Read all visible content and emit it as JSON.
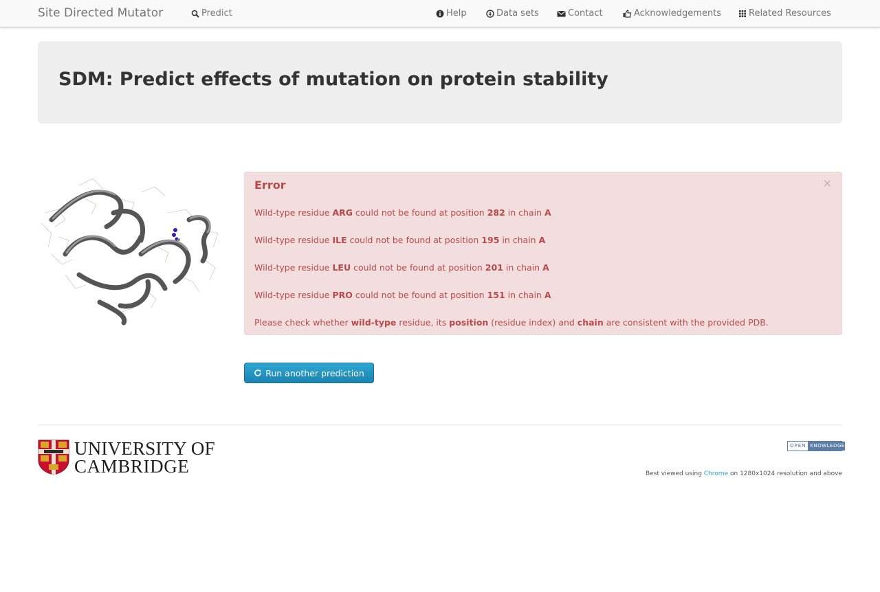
{
  "navbar": {
    "brand": "Site Directed Mutator",
    "items": [
      {
        "label": "Predict",
        "icon": "search-icon"
      },
      {
        "label": "Help",
        "icon": "info-icon"
      },
      {
        "label": "Data sets",
        "icon": "download-icon"
      },
      {
        "label": "Contact",
        "icon": "envelope-icon"
      },
      {
        "label": "Acknowledgements",
        "icon": "thumbs-up-icon"
      },
      {
        "label": "Related Resources",
        "icon": "grid-icon"
      }
    ]
  },
  "hero": {
    "title": "SDM: Predict effects of mutation on protein stability"
  },
  "alert": {
    "title": "Error",
    "close": "×",
    "lines": [
      {
        "prefix": "Wild-type residue",
        "residue": "ARG",
        "middle": "could not be found at position",
        "position": "282",
        "chain_label": "in chain",
        "chain": "A"
      },
      {
        "prefix": "Wild-type residue",
        "residue": "ILE",
        "middle": "could not be found at position",
        "position": "195",
        "chain_label": "in chain",
        "chain": "A"
      },
      {
        "prefix": "Wild-type residue",
        "residue": "LEU",
        "middle": "could not be found at position",
        "position": "201",
        "chain_label": "in chain",
        "chain": "A"
      },
      {
        "prefix": "Wild-type residue",
        "residue": "PRO",
        "middle": "could not be found at position",
        "position": "151",
        "chain_label": "in chain",
        "chain": "A"
      }
    ],
    "note": {
      "p1": "Please check whether",
      "b1": "wild-type",
      "p2": "residue, its",
      "b2": "position",
      "p3": "(residue index) and",
      "b3": "chain",
      "p4": "are consistent with the provided PDB."
    }
  },
  "actions": {
    "run_another": "Run another prediction"
  },
  "footer": {
    "logo_line1": "UNIVERSITY OF",
    "logo_line2": "CAMBRIDGE",
    "badge_open": "OPEN",
    "badge_knowledge": "KNOWLEDGE",
    "best_prefix": "Best viewed using",
    "best_link": "Chrome",
    "best_suffix": "on 1280x1024 resolution and above"
  },
  "colors": {
    "alert_text": "#b94a48",
    "alert_bg": "#f2dede",
    "button": "#1b83b0",
    "hero_bg": "#eeeeee"
  }
}
